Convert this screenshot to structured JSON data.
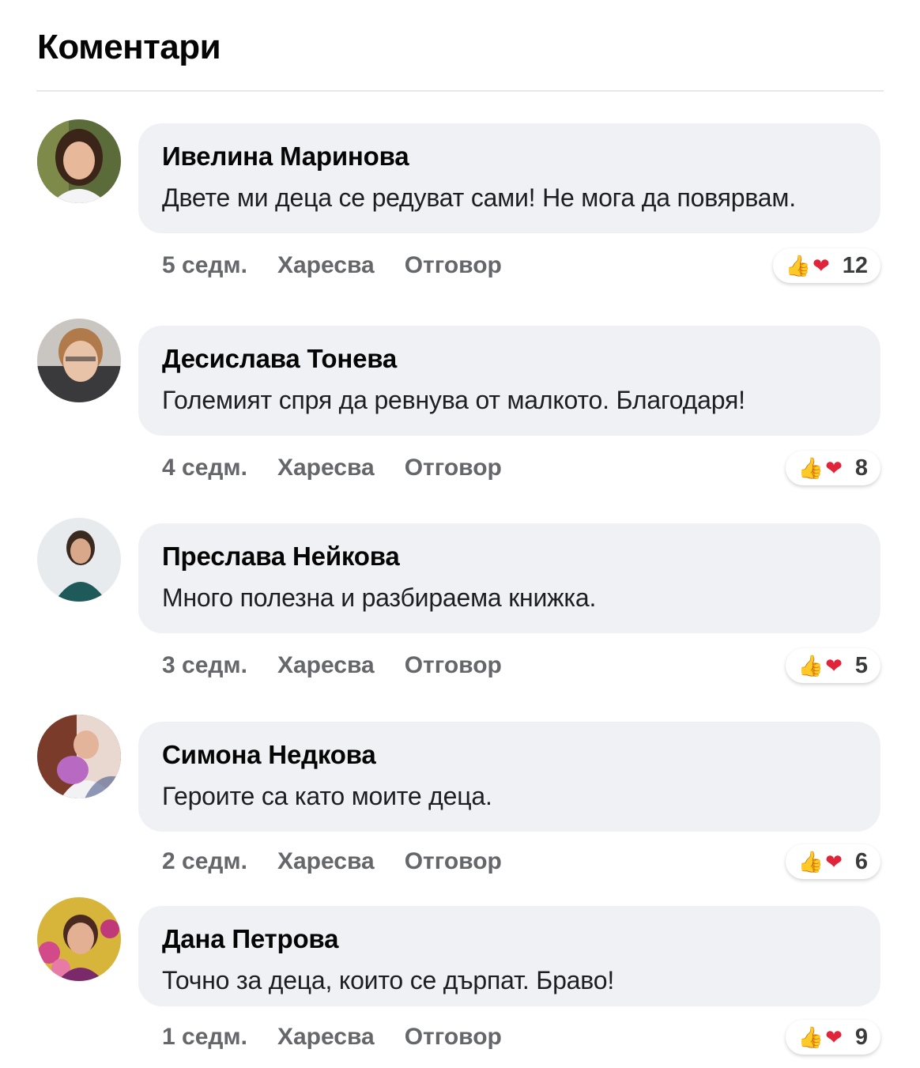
{
  "header": {
    "title": "Коментари"
  },
  "actions": {
    "like": "Харесва",
    "reply": "Отговор"
  },
  "comments": [
    {
      "author": "Ивелина Маринова",
      "text": "Двете ми деца се редуват сами! Не мога да повярвам.",
      "time": "5 седм.",
      "reactions": "12"
    },
    {
      "author": "Десислава Тонева",
      "text": "Големият спря да ревнува от малкото. Благодаря!",
      "time": "4 седм.",
      "reactions": "8"
    },
    {
      "author": "Преслава Нейкова",
      "text": "Много полезна и разбираема книжка.",
      "time": "3 седм.",
      "reactions": "5"
    },
    {
      "author": "Симона Недкова",
      "text": "Героите са като моите деца.",
      "time": "2 седм.",
      "reactions": "6"
    },
    {
      "author": "Дана Петрова",
      "text": "Точно за деца, които се дърпат. Браво!",
      "time": "1 седм.",
      "reactions": "9"
    }
  ],
  "icons": {
    "like": "thumbs-up-icon",
    "love": "heart-icon"
  }
}
